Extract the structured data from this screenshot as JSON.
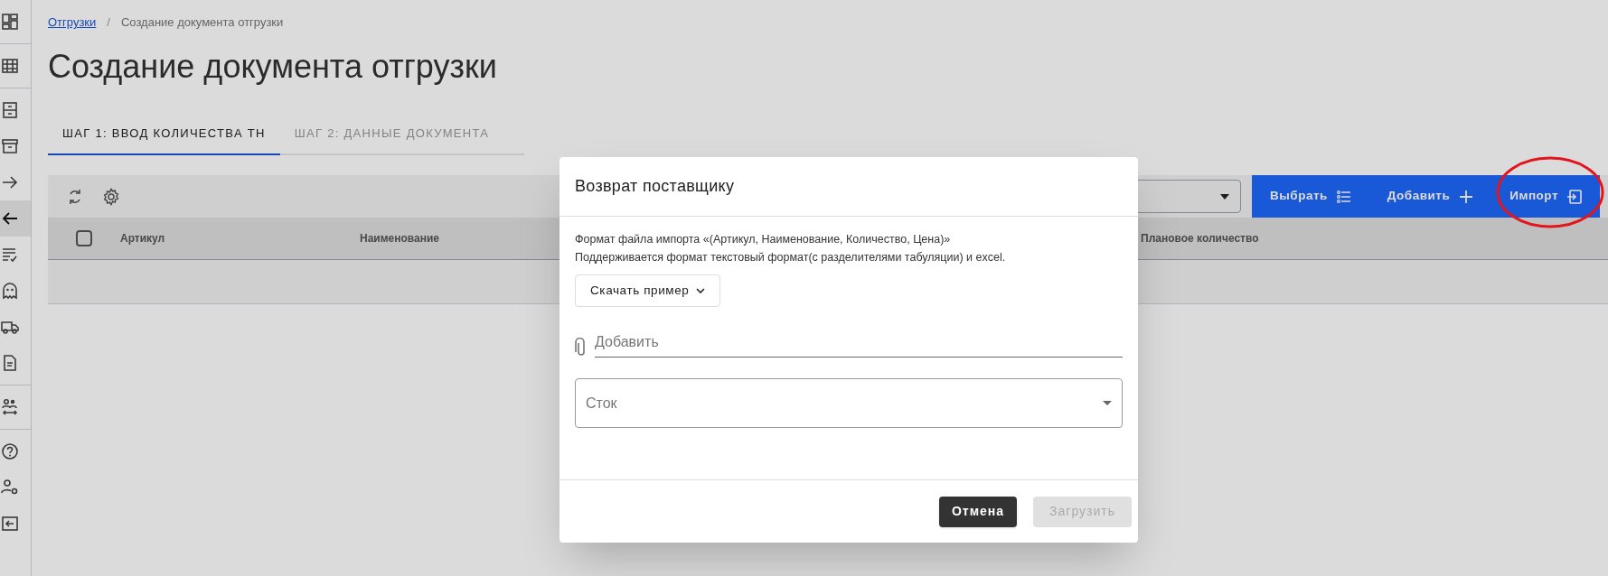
{
  "sidebar": {
    "groups": [
      [
        {
          "kind": "dashboard",
          "selected": false
        }
      ],
      [
        {
          "kind": "grid",
          "selected": false
        }
      ],
      [
        {
          "kind": "cabinet",
          "selected": false
        },
        {
          "kind": "archive",
          "selected": false
        },
        {
          "kind": "arrow-right",
          "selected": false
        },
        {
          "kind": "arrow-left",
          "selected": true
        },
        {
          "kind": "checklist",
          "selected": false
        },
        {
          "kind": "ghost",
          "selected": false
        },
        {
          "kind": "truck",
          "selected": false
        },
        {
          "kind": "document",
          "selected": false
        }
      ],
      [
        {
          "kind": "people",
          "selected": false
        }
      ],
      [
        {
          "kind": "help",
          "selected": false
        },
        {
          "kind": "user-settings",
          "selected": false
        },
        {
          "kind": "logout",
          "selected": false
        }
      ]
    ]
  },
  "breadcrumb": [
    {
      "label": "Отгрузки",
      "link": true
    },
    {
      "label": "Создание документа отгрузки",
      "link": false
    }
  ],
  "breadcrumb_separator": "/",
  "title": "Создание документа отгрузки",
  "tabs": [
    {
      "label": "ШАГ 1: ВВОД КОЛИЧЕСТВА ТН",
      "selected": true
    },
    {
      "label": "ШАГ 2: ДАННЫЕ ДОКУМЕНТА",
      "selected": false
    }
  ],
  "toolbar": {
    "tools": [
      {
        "kind": "refresh"
      },
      {
        "kind": "settings"
      }
    ],
    "actions": [
      {
        "label": "Выбрать",
        "kind": "list"
      },
      {
        "label": "Добавить",
        "kind": "plus"
      },
      {
        "label": "Импорт",
        "kind": "import"
      }
    ]
  },
  "table": {
    "select_all_checked": false,
    "columns": [
      "Артикул",
      "Наименование",
      "Плановое количество"
    ]
  },
  "dialog": {
    "title": "Возврат поставщику",
    "description": [
      "Формат файла импорта «(Артикул, Наименование, Количество, Цена)»",
      "Поддерживается формат текстовый формат(с разделителями табуляции) и excel."
    ],
    "download_button": "Скачать пример",
    "attachment": {
      "placeholder": "Добавить"
    },
    "stock_select": {
      "placeholder": "Сток"
    },
    "buttons": [
      {
        "label": "Отмена",
        "disabled": false
      },
      {
        "label": "Загрузить",
        "disabled": true
      }
    ]
  },
  "annotations": [
    {
      "kind": "ellipse",
      "color": "#e3141b"
    }
  ]
}
